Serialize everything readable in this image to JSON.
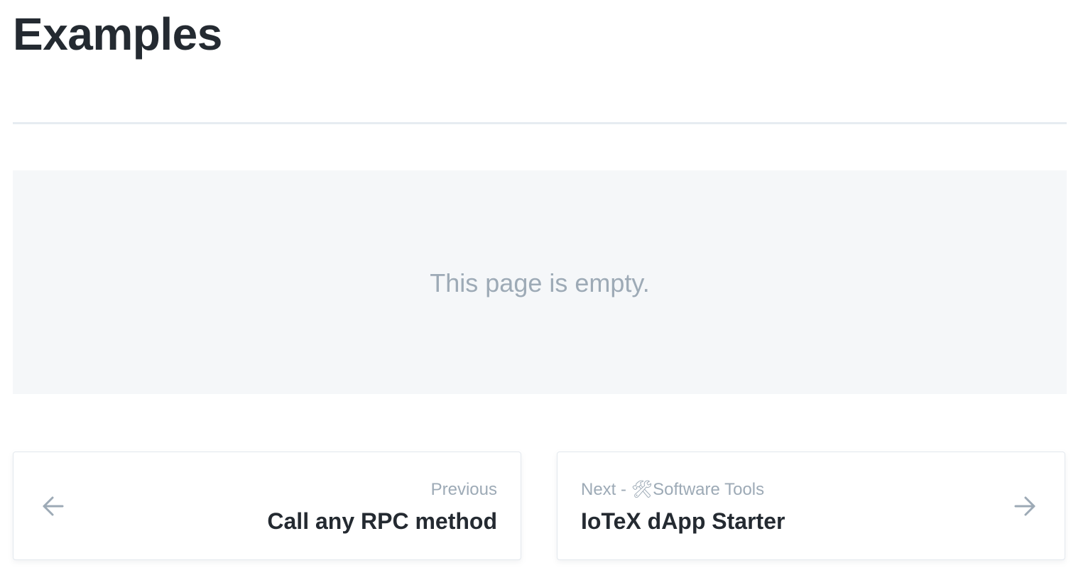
{
  "page": {
    "title": "Examples",
    "empty_message": "This page is empty."
  },
  "pagination": {
    "previous": {
      "kicker": "Previous",
      "label": "Call any RPC method",
      "icon": "arrow-left-icon"
    },
    "next": {
      "kicker": "Next - 🛠Software Tools",
      "label": "IoTeX dApp Starter",
      "icon": "arrow-right-icon"
    }
  },
  "colors": {
    "text": "#242a31",
    "muted": "#9daab6",
    "panel_bg": "#f5f7f9",
    "divider": "#e6ecf1",
    "card_border": "#e3e8ee"
  }
}
